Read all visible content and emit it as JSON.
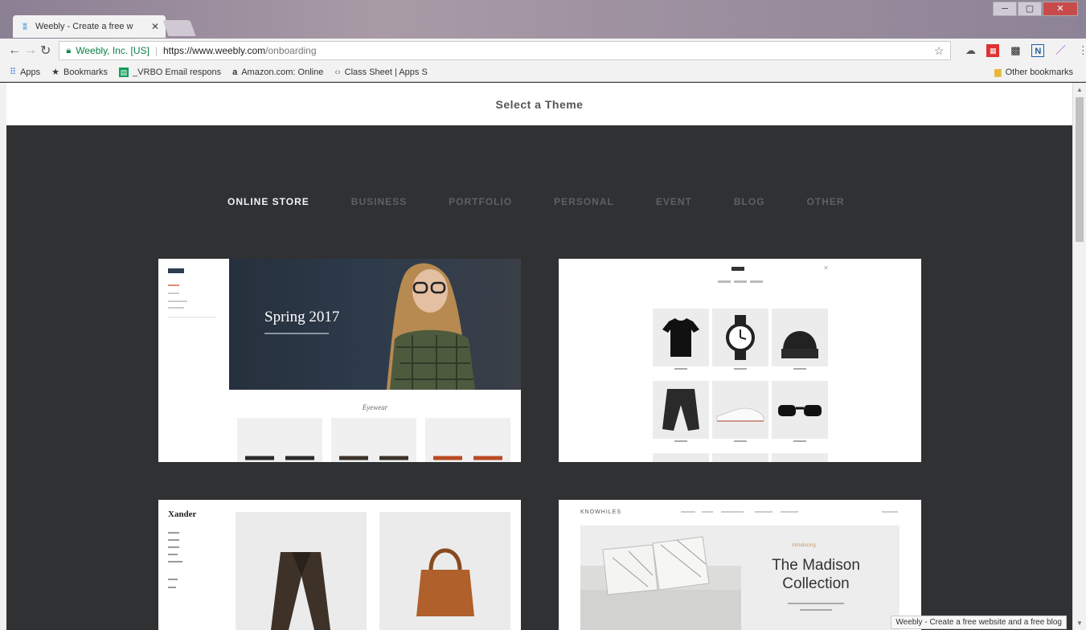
{
  "browser": {
    "tab_title": "Weebly - Create a free w",
    "tab_close": "✕",
    "window_controls": [
      "─",
      "▢",
      "✕"
    ],
    "address": {
      "secure_label": "Weebly, Inc. [US]",
      "url_base": "https://www.weebly.com",
      "url_path": "/onboarding"
    },
    "bookmarks": [
      {
        "icon": "apps-icon",
        "label": "Apps"
      },
      {
        "icon": "star-icon",
        "label": "Bookmarks"
      },
      {
        "icon": "sheets-icon",
        "label": "_VRBO Email respons"
      },
      {
        "icon": "amazon-icon",
        "label": "Amazon.com: Online"
      },
      {
        "icon": "code-icon",
        "label": "Class Sheet | Apps S"
      }
    ],
    "other_bookmarks": "Other bookmarks",
    "status_bar": "Weebly - Create a free website and a free blog"
  },
  "page": {
    "header_title": "Select a Theme",
    "categories": [
      "ONLINE STORE",
      "BUSINESS",
      "PORTFOLIO",
      "PERSONAL",
      "EVENT",
      "BLOG",
      "OTHER"
    ],
    "active_category": "ONLINE STORE",
    "themes": {
      "card1": {
        "hero_title": "Spring 2017",
        "section_title": "Eyewear"
      },
      "card3": {
        "brand": "Xander"
      },
      "card4": {
        "brand": "KNOWHILES",
        "title": "The Madison Collection",
        "intro": "Introducing"
      }
    }
  },
  "colors": {
    "page_bg": "#2f3133",
    "active_category": "#f2f2f2",
    "inactive_category": "#5d6166"
  }
}
